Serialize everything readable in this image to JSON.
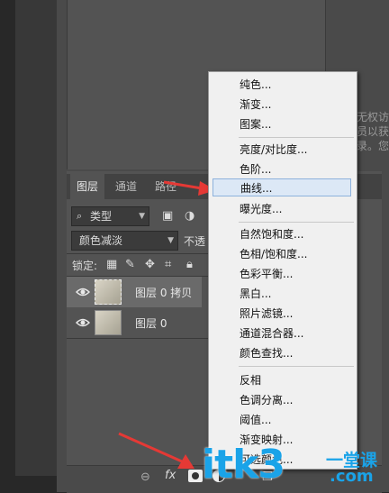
{
  "right_panel_text": "无权访\n员以获\n录。您",
  "layers_panel": {
    "tabs": [
      "图层",
      "通道",
      "路径"
    ],
    "filter_label": "类型",
    "blend_mode": "颜色减淡",
    "opacity_label": "不透",
    "lock_label": "锁定:",
    "layers": [
      {
        "name": "图层 0 拷贝",
        "selected": true
      },
      {
        "name": "图层 0",
        "selected": false
      }
    ],
    "fx_label": "fx"
  },
  "menu": {
    "items": [
      "纯色...",
      "渐变...",
      "图案...",
      "亮度/对比度...",
      "色阶...",
      "曲线...",
      "曝光度...",
      "自然饱和度...",
      "色相/饱和度...",
      "色彩平衡...",
      "黑白...",
      "照片滤镜...",
      "通道混合器...",
      "颜色查找...",
      "反相",
      "色调分离...",
      "阈值...",
      "渐变映射...",
      "可选颜色..."
    ],
    "highlighted": "曲线..."
  },
  "watermark": {
    "brand": "itk3",
    "domain": ".com",
    "chinese": "一堂课"
  },
  "colors": {
    "arrow": "#e53935",
    "menu_highlight": "#dce8f6",
    "watermark_blue": "#1aa3e8"
  }
}
